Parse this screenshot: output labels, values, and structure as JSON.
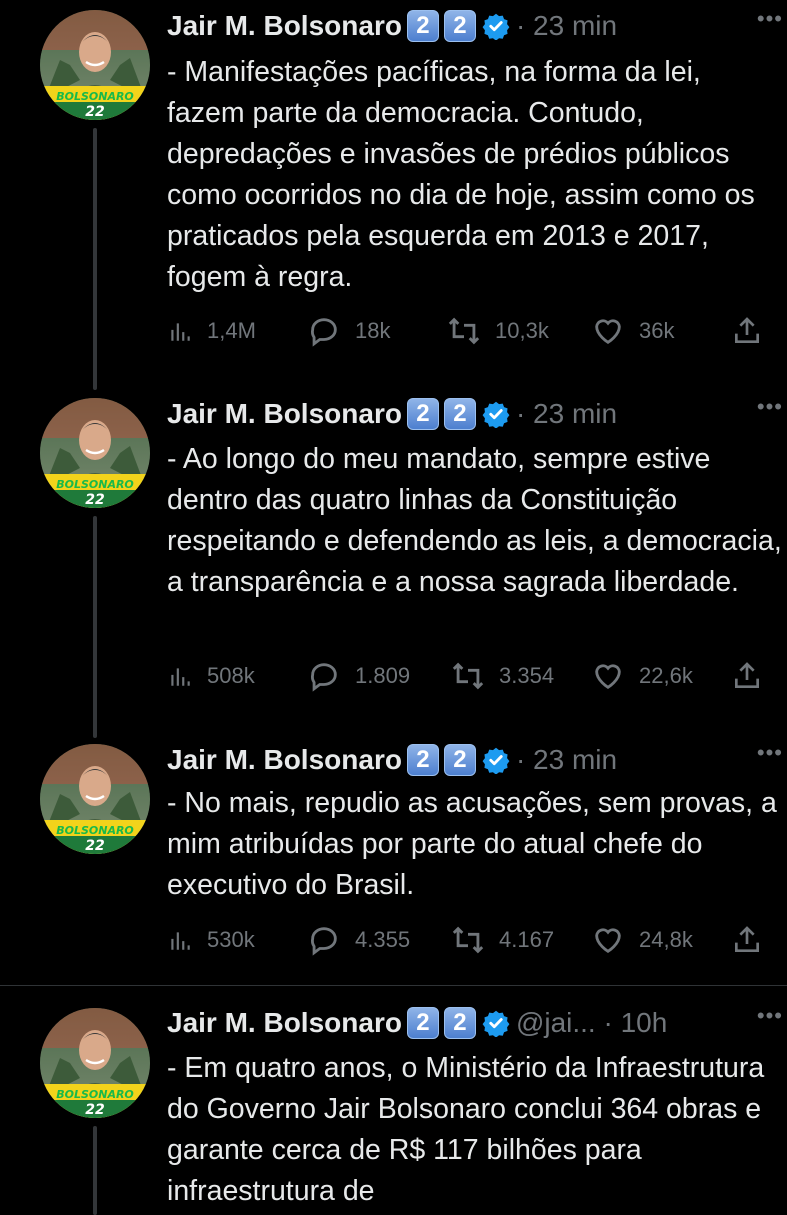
{
  "tweets": [
    {
      "author": "Jair M. Bolsonaro",
      "badges": [
        "2",
        "2"
      ],
      "meta": "· 23 min",
      "text": "- Manifestações pacíficas, na forma da lei, fazem parte da democracia. Contudo, depredações e invasões de prédios públicos como ocorridos no dia de hoje, assim como os praticados pela esquerda em 2013 e 2017, fogem à regra.",
      "views": "1,4M",
      "replies": "18k",
      "retweets": "10,3k",
      "likes": "36k"
    },
    {
      "author": "Jair M. Bolsonaro",
      "badges": [
        "2",
        "2"
      ],
      "meta": "· 23 min",
      "text": "- Ao longo do meu mandato, sempre estive dentro das quatro linhas da Constituição respeitando e defendendo as leis, a democracia, a transparência e a nossa sagrada liberdade.",
      "views": "508k",
      "replies": "1.809",
      "retweets": "3.354",
      "likes": "22,6k"
    },
    {
      "author": "Jair M. Bolsonaro",
      "badges": [
        "2",
        "2"
      ],
      "meta": "· 23 min",
      "text": "- No mais, repudio as acusações, sem provas, a mim atribuídas por parte do atual chefe do executivo do Brasil.",
      "views": "530k",
      "replies": "4.355",
      "retweets": "4.167",
      "likes": "24,8k"
    },
    {
      "author": "Jair M. Bolsonaro",
      "badges": [
        "2",
        "2"
      ],
      "meta": "@jai... · 10h",
      "text": "- Em quatro anos, o Ministério da Infraestrutura do Governo Jair Bolsonaro conclui 364 obras e garante cerca de R$ 117 bilhões para infraestrutura de"
    }
  ],
  "avatar_caption": [
    "BOLSONARO",
    "22"
  ],
  "more_glyph": "•••",
  "colors": {
    "background": "#000000",
    "text": "#e7e9ea",
    "muted": "#71767b",
    "verified": "#1d9bf0"
  }
}
